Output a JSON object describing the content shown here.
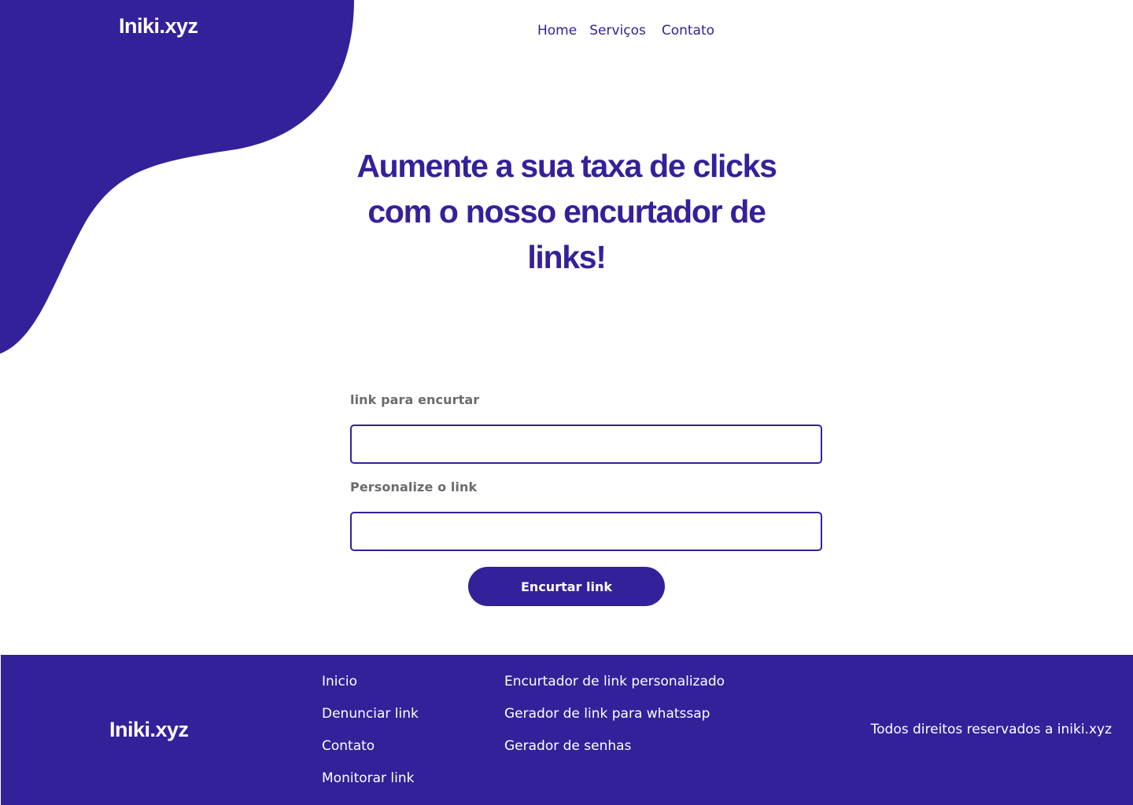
{
  "brand": {
    "name": "Iniki.xyz",
    "color": "#33219a"
  },
  "nav": {
    "items": [
      "Home",
      "Serviços",
      "Contato"
    ]
  },
  "hero": {
    "headline": "Aumente a sua taxa de clicks com o nosso encurtador de links!"
  },
  "form": {
    "link_label": "link para encurtar",
    "link_value": "",
    "custom_label": "Personalize o link",
    "custom_value": "",
    "submit_label": "Encurtar link"
  },
  "footer": {
    "logo": "Iniki.xyz",
    "col1": [
      "Inicio",
      "Denunciar link",
      "Contato",
      "Monitorar link"
    ],
    "col2": [
      "Encurtador de link personalizado",
      "Gerador de link para whatssap",
      "Gerador de senhas"
    ],
    "copyright": "Todos direitos reservados a iniki.xyz"
  }
}
